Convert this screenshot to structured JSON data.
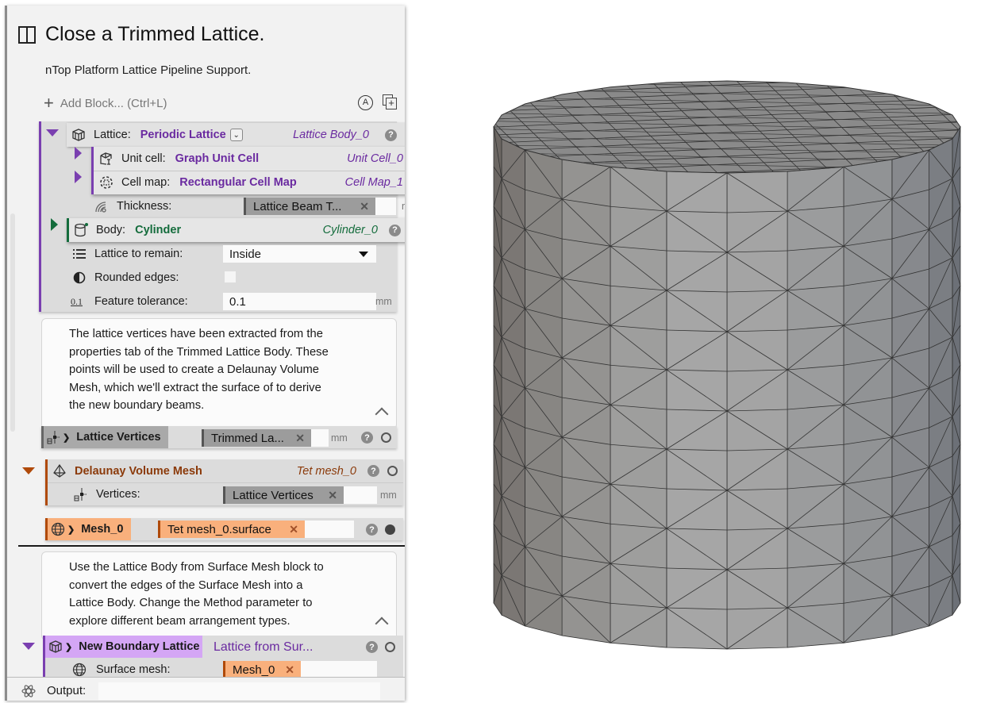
{
  "panel": {
    "title": "Close a Trimmed Lattice.",
    "subtitle": "nTop Platform Lattice Pipeline Support.",
    "add_block": "Add Block... (Ctrl+L)",
    "icons": {
      "title": "panel-split-icon",
      "auto": "auto-update-icon",
      "duplicate": "duplicate-icon"
    }
  },
  "lattice_block": {
    "lattice": {
      "label": "Lattice:",
      "value": "Periodic Lattice",
      "name": "Lattice Body_0"
    },
    "unit_cell": {
      "label": "Unit cell:",
      "value": "Graph Unit Cell",
      "name": "Unit Cell_0"
    },
    "cell_map": {
      "label": "Cell map:",
      "value": "Rectangular Cell Map",
      "name": "Cell Map_1"
    },
    "thickness": {
      "label": "Thickness:",
      "value": "Lattice Beam T...",
      "unit": "mm"
    },
    "body": {
      "label": "Body:",
      "value": "Cylinder",
      "name": "Cylinder_0"
    },
    "lattice_to_remain": {
      "label": "Lattice to remain:",
      "value": "Inside"
    },
    "rounded_edges": {
      "label": "Rounded edges:",
      "checked": false
    },
    "feature_tolerance": {
      "label": "Feature tolerance:",
      "value": "0.1",
      "unit": "mm",
      "icon_text": "0.1"
    }
  },
  "note1": {
    "lines": [
      "The lattice vertices have been extracted from the",
      "properties tab of the Trimmed Lattice Body. These",
      "points will be used to create a Delaunay Volume",
      "Mesh, which we'll extract the surface of to derive",
      "the new boundary beams."
    ]
  },
  "lattice_vertices": {
    "label": "Lattice Vertices",
    "value": "Trimmed La...",
    "unit": "mm"
  },
  "delaunay": {
    "label": "Delaunay Volume Mesh",
    "name": "Tet mesh_0",
    "vertices": {
      "label": "Vertices:",
      "value": "Lattice Vertices",
      "unit": "mm"
    }
  },
  "mesh": {
    "label": "Mesh_0",
    "value": "Tet mesh_0.surface"
  },
  "note2": {
    "lines": [
      "Use the Lattice Body from Surface Mesh block to",
      "convert the edges of the Surface Mesh into a",
      "Lattice Body. Change the Method parameter to",
      "explore different beam arrangement types."
    ]
  },
  "new_boundary": {
    "label": "New Boundary Lattice",
    "name": "Lattice from Sur...",
    "surface_mesh": {
      "label": "Surface mesh:",
      "value": "Mesh_0"
    }
  },
  "output": {
    "label": "Output:",
    "value": ""
  },
  "colors": {
    "lattice_purple": "#6a2aa0",
    "body_green": "#146c3c",
    "mesh_orange": "#f9b07c",
    "delaunay_brown": "#b04a0a",
    "boundary_lilac": "#d4a6f5"
  },
  "viewport": {
    "object": "cylinder-mesh",
    "segments": 24,
    "rings": 12
  }
}
